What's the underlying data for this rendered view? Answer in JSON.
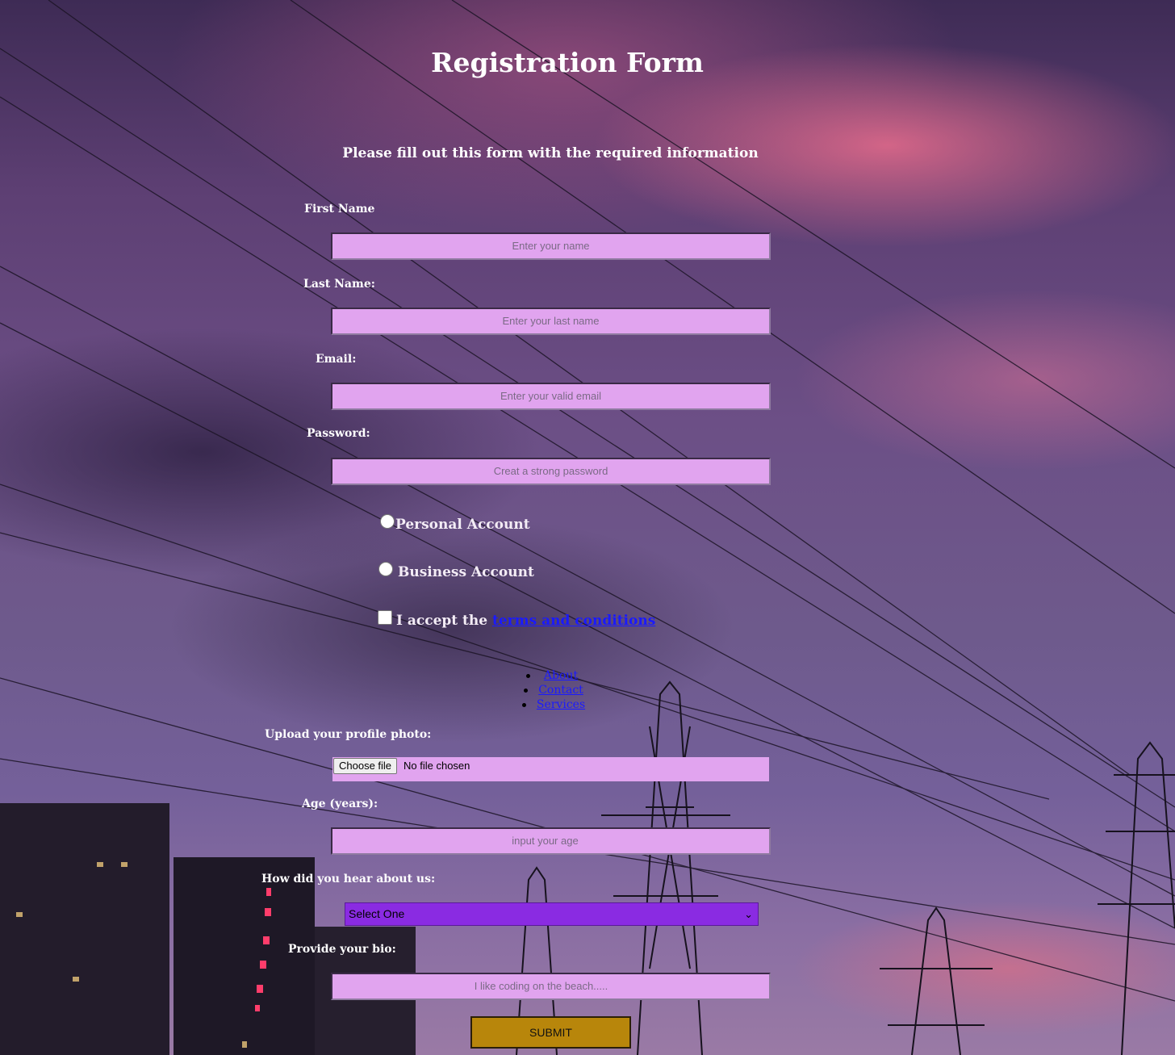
{
  "page": {
    "title": "Registration Form",
    "subtitle": "Please fill out this form with the required information"
  },
  "form": {
    "first_name": {
      "label": "First Name",
      "placeholder": "Enter your name"
    },
    "last_name": {
      "label": "Last Name:",
      "placeholder": "Enter your last name"
    },
    "email": {
      "label": "Email:",
      "placeholder": "Enter your valid email"
    },
    "password": {
      "label": "Password:",
      "placeholder": "Creat a strong password"
    },
    "account_type": {
      "personal_label": "Personal Account",
      "business_label": "Business Account"
    },
    "terms": {
      "prefix": "I accept the",
      "link_text": "terms and conditions"
    },
    "photo": {
      "label": "Upload your profile photo:",
      "button_label": "Choose file",
      "status": "No file chosen"
    },
    "age": {
      "label": "Age (years):",
      "placeholder": "input your age"
    },
    "referral": {
      "label": "How did you hear about us:",
      "selected": "Select One"
    },
    "bio": {
      "label": "Provide your bio:",
      "placeholder": "I like coding on the beach....."
    },
    "submit_label": "SUBMIT"
  },
  "nav": {
    "items": [
      {
        "label": "About"
      },
      {
        "label": "Contact"
      },
      {
        "label": "Services"
      }
    ]
  },
  "colors": {
    "input_bg": "#e1a4ef",
    "select_bg": "#8a2be2",
    "submit_bg": "#b8860b",
    "link": "#1a1aff"
  }
}
